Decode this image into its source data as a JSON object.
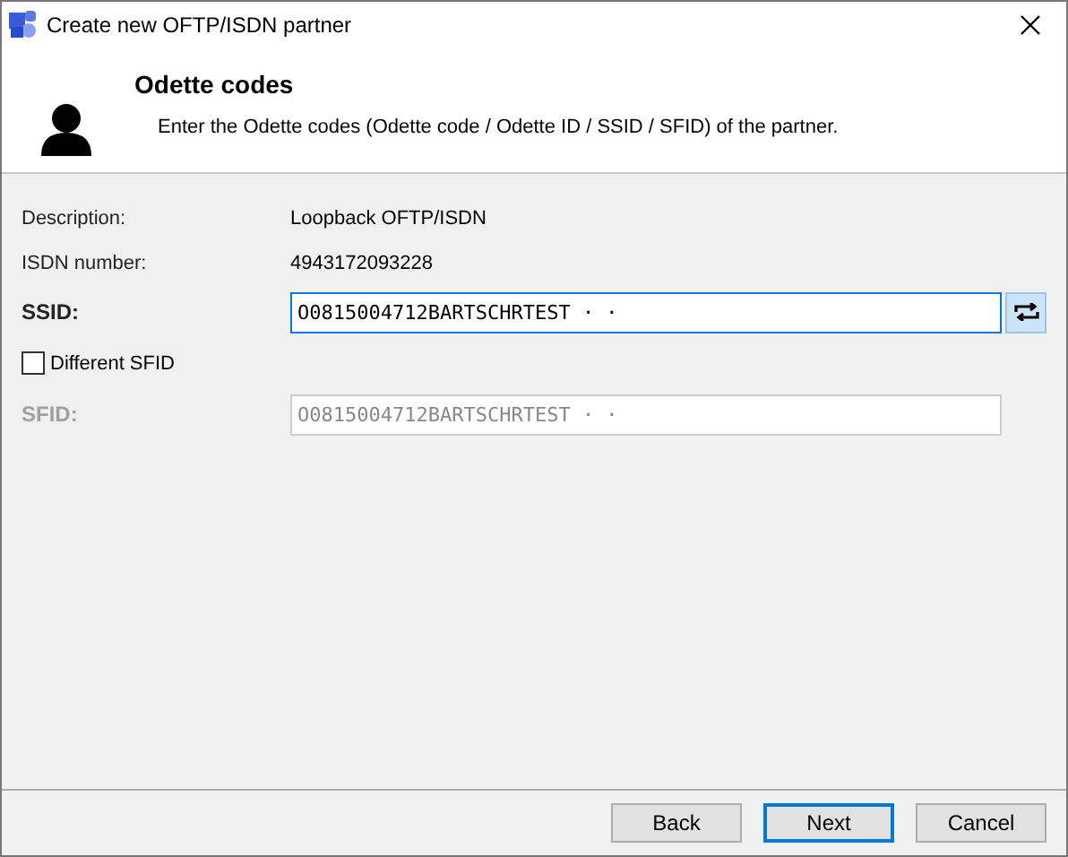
{
  "window": {
    "title": "Create new OFTP/ISDN partner"
  },
  "header": {
    "title": "Odette codes",
    "subtitle": "Enter the Odette codes (Odette code / Odette ID / SSID / SFID) of the partner."
  },
  "info": [
    {
      "label": "Description:",
      "value": "Loopback OFTP/ISDN"
    },
    {
      "label": "ISDN number:",
      "value": "4943172093228"
    }
  ],
  "ssid": {
    "label": "SSID:",
    "value": "O0815004712BARTSCHRTEST · ·"
  },
  "different_sfid": {
    "label": "Different SFID",
    "checked": false
  },
  "sfid": {
    "label": "SFID:",
    "value": "O0815004712BARTSCHRTEST · ·",
    "disabled": true
  },
  "buttons": [
    {
      "label": "Back",
      "default": false
    },
    {
      "label": "Next",
      "default": true
    },
    {
      "label": "Cancel",
      "default": false
    }
  ]
}
